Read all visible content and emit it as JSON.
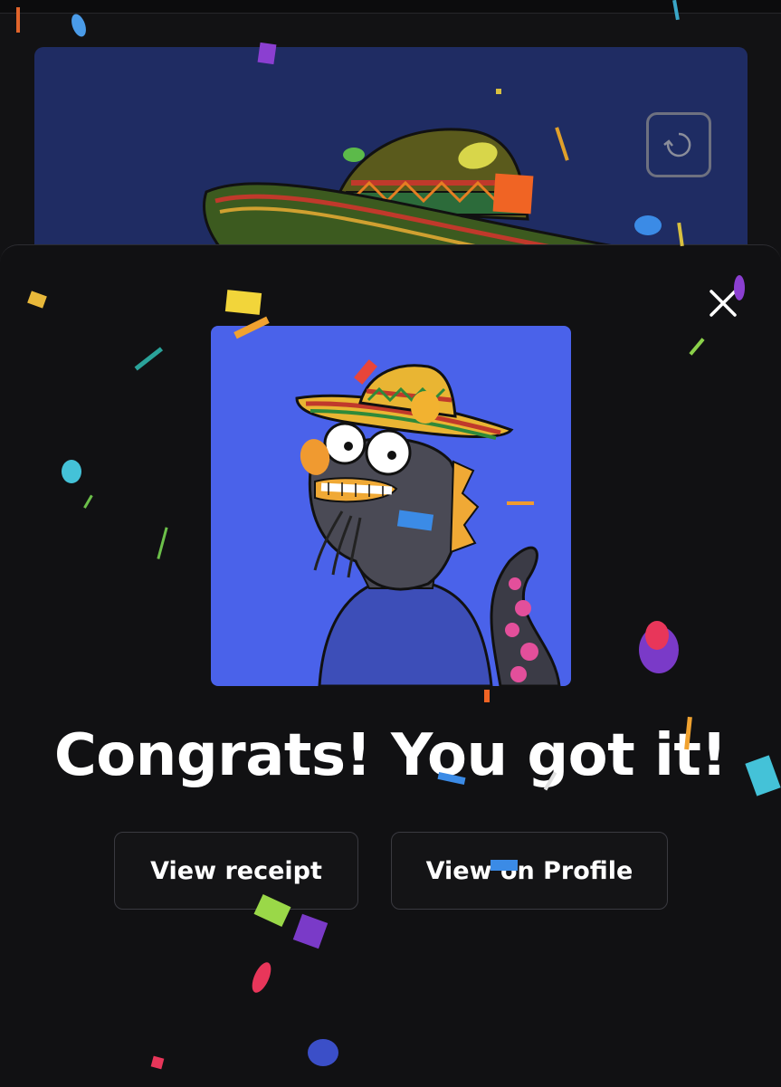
{
  "modal": {
    "title": "Congrats! You got it!",
    "close_icon": "close-icon"
  },
  "actions": {
    "view_receipt": "View receipt",
    "view_on_profile": "View on Profile"
  },
  "background_card": {
    "refresh_icon": "refresh-icon"
  },
  "colors": {
    "page_bg": "#121214",
    "modal_bg": "#111113",
    "nft_bg": "#4a62ea",
    "bg_card": "#1f2c63"
  }
}
